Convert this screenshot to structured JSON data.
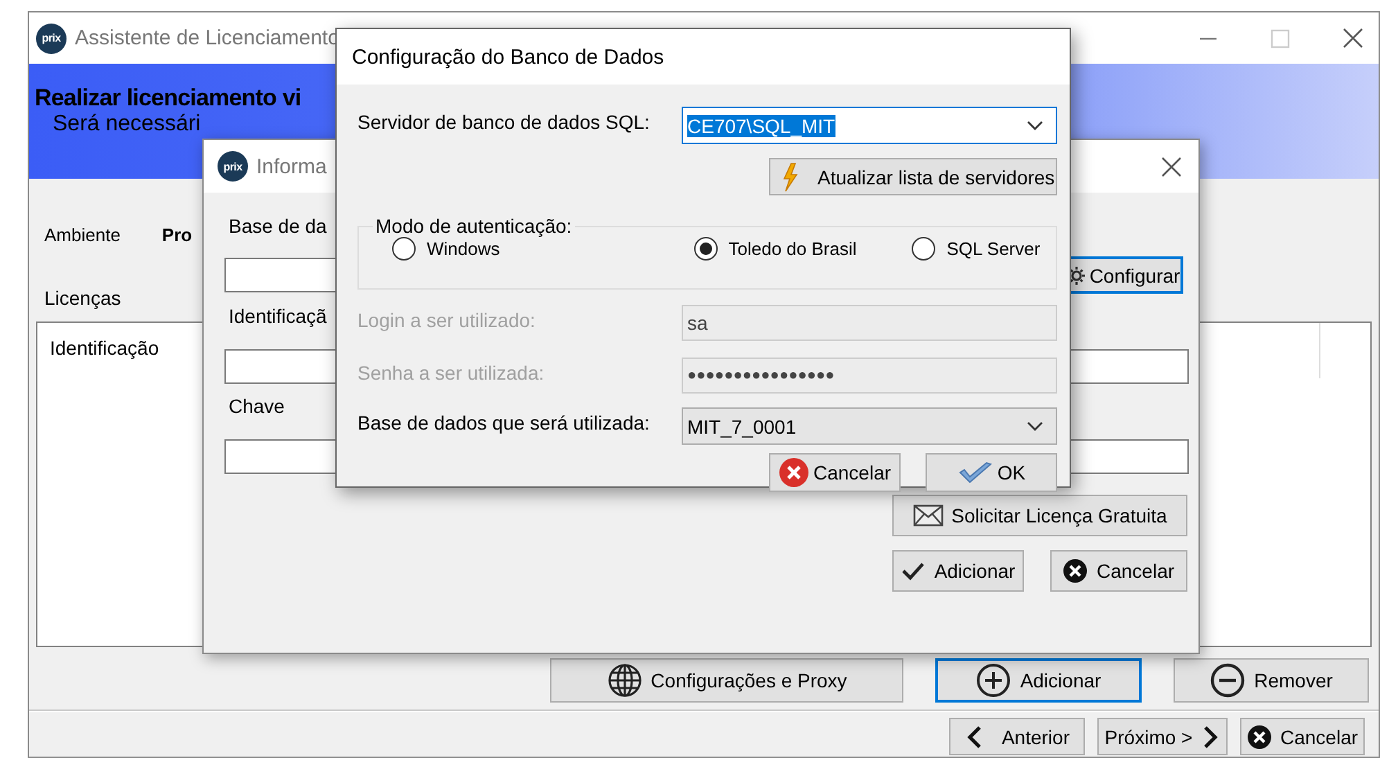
{
  "main_window": {
    "logo": "prix",
    "title": "Assistente de Licenciamento",
    "header": {
      "title": "Realizar licenciamento vi",
      "subtitle": "Será necessári"
    },
    "environment": {
      "label": "Ambiente",
      "value": "Pro"
    },
    "licenses": {
      "label": "Licenças",
      "columns": [
        "Identificação"
      ]
    },
    "buttons": [
      {
        "label": "Configurações e Proxy",
        "kind": "proxy",
        "focused": false
      },
      {
        "label": "Adicionar",
        "kind": "add",
        "focused": true
      },
      {
        "label": "Remover",
        "kind": "remove",
        "focused": false
      }
    ],
    "nav_buttons": [
      {
        "label": "Anterior",
        "kind": "back"
      },
      {
        "label": "Próximo >",
        "kind": "next"
      },
      {
        "label": "Cancelar",
        "kind": "cancel"
      }
    ]
  },
  "info_dialog": {
    "logo": "prix",
    "title": "Informa",
    "fields": [
      {
        "label": "Base de da",
        "kind": "with_button"
      },
      {
        "label": "Identificaçã",
        "kind": "plain"
      },
      {
        "label": "Chave",
        "kind": "plain"
      }
    ],
    "configure_button": {
      "label": "Configurar",
      "focused": true
    },
    "request_button": {
      "label": "Solicitar Licença Gratuita",
      "kind": "mail"
    },
    "buttons": [
      {
        "label": "Adicionar",
        "kind": "confirm"
      },
      {
        "label": "Cancelar",
        "kind": "cancel"
      }
    ]
  },
  "db_dialog": {
    "title": "Configuração do Banco de Dados",
    "server": {
      "label": "Servidor de banco de dados SQL:",
      "value": "CE707\\SQL_MIT",
      "text_selected": true
    },
    "refresh_button": {
      "label": "Atualizar lista de servidores",
      "kind": "refresh"
    },
    "auth": {
      "legend": "Modo de autenticação:",
      "options": [
        {
          "label": "Windows",
          "selected": false
        },
        {
          "label": "Toledo do Brasil",
          "selected": true
        },
        {
          "label": "SQL Server",
          "selected": false
        }
      ]
    },
    "login": {
      "label": "Login a ser utilizado:",
      "value": "sa",
      "disabled": true
    },
    "password": {
      "label": "Senha a ser utilizada:",
      "value": "●●●●●●●●●●●●●●●●",
      "disabled": true
    },
    "database": {
      "label": "Base de dados que será utilizada:",
      "value": "MIT_7_0001"
    },
    "buttons": [
      {
        "label": "Cancelar",
        "kind": "cancel_red"
      },
      {
        "label": "OK",
        "kind": "ok"
      }
    ]
  }
}
